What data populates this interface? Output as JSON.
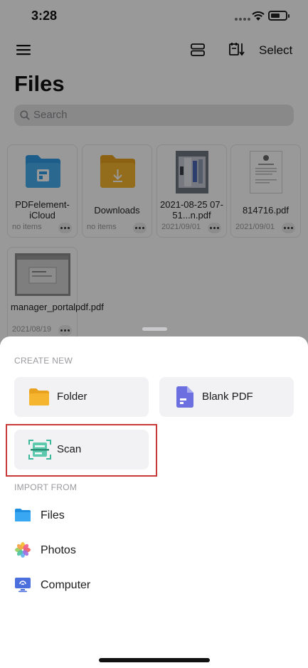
{
  "status_bar": {
    "time": "3:28"
  },
  "header": {
    "select_label": "Select",
    "title": "Files"
  },
  "search": {
    "placeholder": "Search"
  },
  "files": [
    {
      "name": "PDFelement-iCloud",
      "meta": "no items",
      "icon": "icloud-folder-icon"
    },
    {
      "name": "Downloads",
      "meta": "no items",
      "icon": "downloads-folder-icon"
    },
    {
      "name": "2021-08-25 07-51...n.pdf",
      "meta": "2021/09/01",
      "icon": "document-thumbnail"
    },
    {
      "name": "814716.pdf",
      "meta": "2021/09/01",
      "icon": "document-thumbnail"
    },
    {
      "name": "manager_portalpdf.pdf",
      "meta": "2021/08/19",
      "icon": "document-thumbnail"
    }
  ],
  "sheet": {
    "create_new_label": "CREATE NEW",
    "create_items": [
      {
        "label": "Folder",
        "icon": "folder-icon"
      },
      {
        "label": "Blank PDF",
        "icon": "blank-pdf-icon"
      },
      {
        "label": "Scan",
        "icon": "scan-icon"
      }
    ],
    "import_from_label": "IMPORT FROM",
    "import_items": [
      {
        "label": "Files",
        "icon": "files-app-icon"
      },
      {
        "label": "Photos",
        "icon": "photos-app-icon"
      },
      {
        "label": "Computer",
        "icon": "computer-icon"
      }
    ]
  },
  "colors": {
    "highlight": "#c83a3a",
    "folder_yellow": "#f5b52f",
    "folder_blue": "#2f9be6",
    "pdf_purple": "#6b6fe0",
    "scan_green": "#3bb79a"
  }
}
